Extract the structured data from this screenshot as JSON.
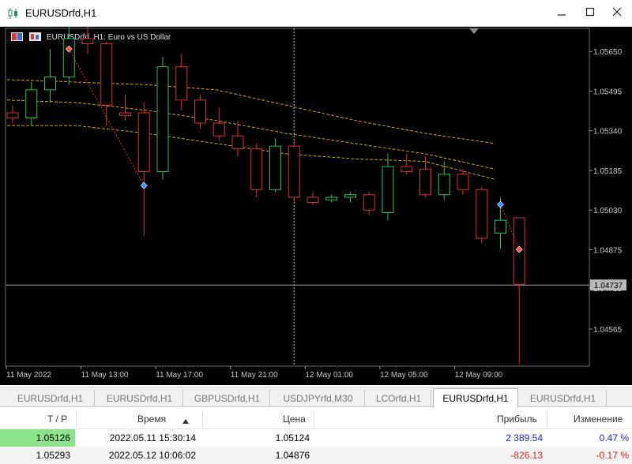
{
  "window": {
    "title": "EURUSDrfd,H1",
    "minimize_icon": "minimize-icon",
    "maximize_icon": "maximize-icon",
    "close_icon": "close-icon"
  },
  "chart": {
    "header_text": "EURUSDrfd, H1:  Euro vs US Dollar",
    "current_price_tag": "1.04737",
    "colors": {
      "background": "#000000",
      "bull_candle": "#22c55e",
      "bear_candle": "#e03131",
      "ma_line": "#d4a017",
      "bid_line": "#9a9a9a"
    }
  },
  "chart_data": {
    "type": "candlestick",
    "symbol": "EURUSDrfd",
    "timeframe": "H1",
    "x_ticks": [
      "11 May 2022",
      "11 May 13:00",
      "11 May 17:00",
      "11 May 21:00",
      "12 May 01:00",
      "12 May 05:00",
      "12 May 09:00"
    ],
    "y_ticks": [
      1.0565,
      1.05495,
      1.0534,
      1.05185,
      1.0503,
      1.04875,
      1.04725,
      1.04565
    ],
    "ylim": [
      1.0442,
      1.0574
    ],
    "current_price": 1.04737,
    "candles": [
      {
        "o": 1.0541,
        "h": 1.0544,
        "l": 1.0537,
        "c": 1.0539
      },
      {
        "o": 1.0539,
        "h": 1.0553,
        "l": 1.0536,
        "c": 1.055
      },
      {
        "o": 1.055,
        "h": 1.0566,
        "l": 1.0545,
        "c": 1.0555
      },
      {
        "o": 1.0555,
        "h": 1.0576,
        "l": 1.0552,
        "c": 1.057
      },
      {
        "o": 1.057,
        "h": 1.0577,
        "l": 1.0564,
        "c": 1.0568
      },
      {
        "o": 1.0568,
        "h": 1.0569,
        "l": 1.0536,
        "c": 1.0544
      },
      {
        "o": 1.0541,
        "h": 1.0548,
        "l": 1.0538,
        "c": 1.054
      },
      {
        "o": 1.0541,
        "h": 1.0545,
        "l": 1.0493,
        "c": 1.0518
      },
      {
        "o": 1.0518,
        "h": 1.0563,
        "l": 1.0515,
        "c": 1.0559
      },
      {
        "o": 1.0559,
        "h": 1.0564,
        "l": 1.0542,
        "c": 1.0546
      },
      {
        "o": 1.0546,
        "h": 1.0548,
        "l": 1.0535,
        "c": 1.0537
      },
      {
        "o": 1.0537,
        "h": 1.0543,
        "l": 1.053,
        "c": 1.0532
      },
      {
        "o": 1.0532,
        "h": 1.0538,
        "l": 1.0524,
        "c": 1.0527
      },
      {
        "o": 1.0527,
        "h": 1.0529,
        "l": 1.0508,
        "c": 1.0511
      },
      {
        "o": 1.0511,
        "h": 1.0531,
        "l": 1.051,
        "c": 1.0528
      },
      {
        "o": 1.0528,
        "h": 1.053,
        "l": 1.0506,
        "c": 1.0508
      },
      {
        "o": 1.0508,
        "h": 1.051,
        "l": 1.0505,
        "c": 1.0506
      },
      {
        "o": 1.0507,
        "h": 1.0509,
        "l": 1.0506,
        "c": 1.0508
      },
      {
        "o": 1.0508,
        "h": 1.051,
        "l": 1.0506,
        "c": 1.0509
      },
      {
        "o": 1.0509,
        "h": 1.051,
        "l": 1.0501,
        "c": 1.0503
      },
      {
        "o": 1.0502,
        "h": 1.0525,
        "l": 1.0499,
        "c": 1.052
      },
      {
        "o": 1.052,
        "h": 1.0525,
        "l": 1.0517,
        "c": 1.0518
      },
      {
        "o": 1.0519,
        "h": 1.0524,
        "l": 1.0508,
        "c": 1.0509
      },
      {
        "o": 1.0509,
        "h": 1.0522,
        "l": 1.0507,
        "c": 1.0517
      },
      {
        "o": 1.0517,
        "h": 1.0519,
        "l": 1.0509,
        "c": 1.0511
      },
      {
        "o": 1.0511,
        "h": 1.0512,
        "l": 1.049,
        "c": 1.0492
      },
      {
        "o": 1.0494,
        "h": 1.0508,
        "l": 1.0488,
        "c": 1.0499
      },
      {
        "o": 1.05,
        "h": 1.05,
        "l": 1.0443,
        "c": 1.0474
      }
    ],
    "moving_averages": [
      {
        "values": [
          1.0554,
          1.0553,
          1.0552,
          1.055,
          1.0544,
          1.0538,
          1.0533,
          1.0529
        ]
      },
      {
        "values": [
          1.0546,
          1.0545,
          1.0542,
          1.0538,
          1.0533,
          1.0529,
          1.0525,
          1.0519
        ]
      },
      {
        "values": [
          1.0536,
          1.0536,
          1.0533,
          1.0529,
          1.0525,
          1.0523,
          1.0522,
          1.0515
        ]
      }
    ],
    "trade_markers": [
      {
        "candle": 3,
        "price": 1.0566,
        "side": "sell"
      },
      {
        "candle": 7,
        "price": 1.05126,
        "side": "buy"
      },
      {
        "candle": 26,
        "price": 1.05052,
        "side": "buy"
      },
      {
        "candle": 27,
        "price": 1.04876,
        "side": "sell"
      }
    ],
    "period_separator_candle": 15
  },
  "tabs": [
    {
      "label": "EURUSDrfd,H1",
      "active": false
    },
    {
      "label": "EURUSDrfd,H1",
      "active": false
    },
    {
      "label": "GBPUSDrfd,H1",
      "active": false
    },
    {
      "label": "USDJPYrfd,M30",
      "active": false
    },
    {
      "label": "LCOrfd,H1",
      "active": false
    },
    {
      "label": "EURUSDrfd,H1",
      "active": true
    },
    {
      "label": "EURUSDrfd,H1",
      "active": false
    }
  ],
  "table": {
    "headers": {
      "tp": "T / P",
      "time": "Время",
      "sort_icon": "sort-ascending-icon",
      "price": "Цена",
      "profit": "Прибыль",
      "change": "Изменение"
    },
    "rows": [
      {
        "tp": "1.05126",
        "time": "2022.05.11 15:30:14",
        "price": "1.05124",
        "profit": "2 389.54",
        "change": "0.47 %",
        "profit_color": "#1f1fcc",
        "change_color": "#1f1fcc"
      },
      {
        "tp": "1.05293",
        "time": "2022.05.12 10:06:02",
        "price": "1.04876",
        "profit": "-826.13",
        "change": "-0.17 %",
        "profit_color": "#e02020",
        "change_color": "#e02020"
      }
    ]
  }
}
